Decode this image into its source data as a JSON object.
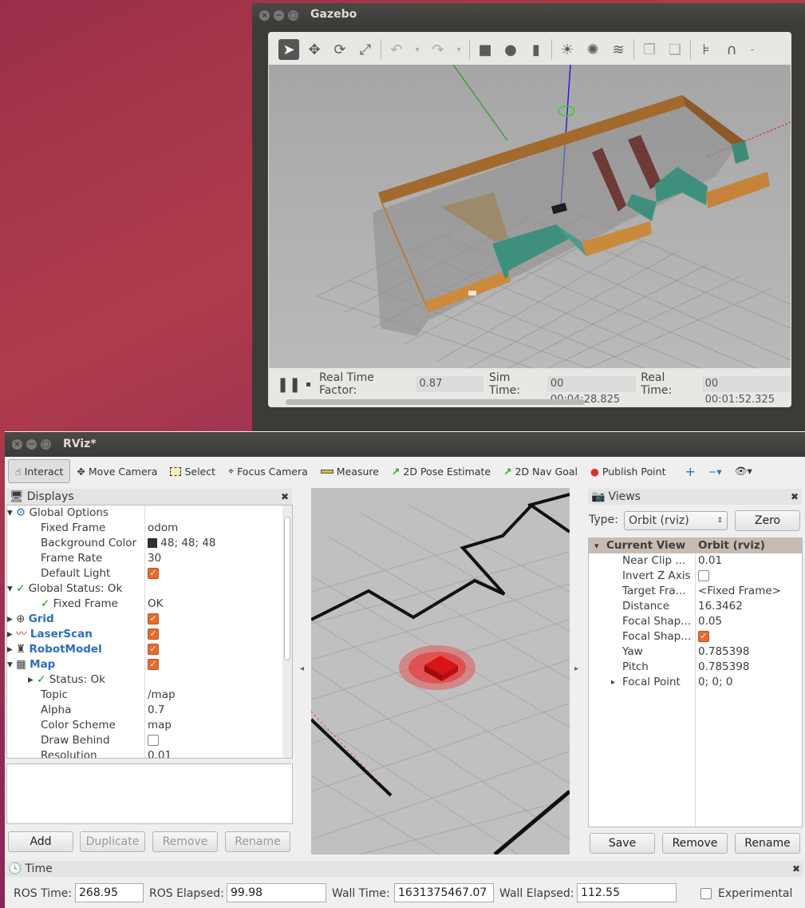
{
  "gazebo": {
    "title": "Gazebo",
    "status": {
      "real_time_factor_label": "Real Time Factor:",
      "real_time_factor": "0.87",
      "sim_time_label": "Sim Time:",
      "sim_time": "00 00:04:28.825",
      "real_time_label": "Real Time:",
      "real_time": "00 00:01:52.325"
    }
  },
  "rviz": {
    "title": "RViz*",
    "tools": [
      "Interact",
      "Move Camera",
      "Select",
      "Focus Camera",
      "Measure",
      "2D Pose Estimate",
      "2D Nav Goal",
      "Publish Point"
    ],
    "displays": {
      "title": "Displays",
      "rows": [
        {
          "k": "Global Options",
          "v": ""
        },
        {
          "k": "Fixed Frame",
          "v": "odom"
        },
        {
          "k": "Background Color",
          "v": "48; 48; 48"
        },
        {
          "k": "Frame Rate",
          "v": "30"
        },
        {
          "k": "Default Light",
          "v": ""
        },
        {
          "k": "Global Status: Ok",
          "v": ""
        },
        {
          "k": "Fixed Frame",
          "v": "OK"
        },
        {
          "k": "Grid",
          "v": ""
        },
        {
          "k": "LaserScan",
          "v": ""
        },
        {
          "k": "RobotModel",
          "v": ""
        },
        {
          "k": "Map",
          "v": ""
        },
        {
          "k": "Status: Ok",
          "v": ""
        },
        {
          "k": "Topic",
          "v": "/map"
        },
        {
          "k": "Alpha",
          "v": "0.7"
        },
        {
          "k": "Color Scheme",
          "v": "map"
        },
        {
          "k": "Draw Behind",
          "v": ""
        },
        {
          "k": "Resolution",
          "v": "0.01"
        }
      ],
      "buttons": [
        "Add",
        "Duplicate",
        "Remove",
        "Rename"
      ]
    },
    "views": {
      "title": "Views",
      "type_label": "Type:",
      "type_value": "Orbit (rviz)",
      "zero_label": "Zero",
      "header_k": "Current View",
      "header_v": "Orbit (rviz)",
      "rows": [
        {
          "k": "Near Clip ...",
          "v": "0.01"
        },
        {
          "k": "Invert Z Axis",
          "v": ""
        },
        {
          "k": "Target Fra...",
          "v": "<Fixed Frame>"
        },
        {
          "k": "Distance",
          "v": "16.3462"
        },
        {
          "k": "Focal Shap...",
          "v": "0.05"
        },
        {
          "k": "Focal Shap...",
          "v": ""
        },
        {
          "k": "Yaw",
          "v": "0.785398"
        },
        {
          "k": "Pitch",
          "v": "0.785398"
        },
        {
          "k": "Focal Point",
          "v": "0; 0; 0"
        }
      ],
      "buttons": [
        "Save",
        "Remove",
        "Rename"
      ]
    },
    "time": {
      "title": "Time",
      "ros_time_label": "ROS Time:",
      "ros_time": "268.95",
      "ros_elapsed_label": "ROS Elapsed:",
      "ros_elapsed": "99.98",
      "wall_time_label": "Wall Time:",
      "wall_time": "1631375467.07",
      "wall_elapsed_label": "Wall Elapsed:",
      "wall_elapsed": "112.55",
      "experimental_label": "Experimental"
    }
  }
}
